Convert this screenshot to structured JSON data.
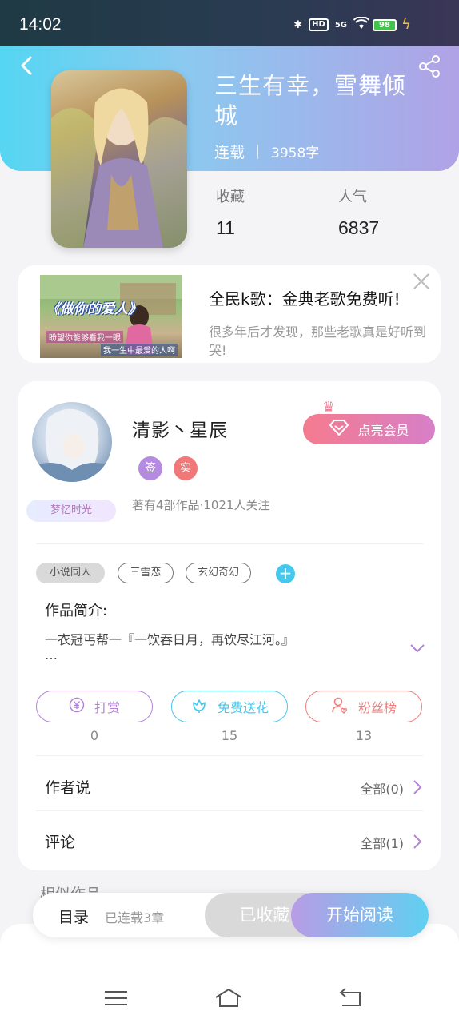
{
  "status_bar": {
    "time": "14:02",
    "network": "5G",
    "hd": "HD",
    "battery": "98"
  },
  "book": {
    "title": "三生有幸，雪舞倾城",
    "status": "连载",
    "words": "3958字",
    "stats": [
      {
        "label": "收藏",
        "value": "11"
      },
      {
        "label": "人气",
        "value": "6837"
      }
    ]
  },
  "ad": {
    "image_caption": "《做你的爱人》",
    "image_sub1": "盼望你能够看我一眼",
    "image_sub2": "我一生中最爱的人啊",
    "title": "全民k歌：金典老歌免费听!",
    "description": "很多年后才发现，那些老歌真是好听到哭!"
  },
  "author": {
    "name": "清影丶星辰",
    "badge": "梦忆时光",
    "tag_sign": "签",
    "tag_real": "实",
    "stats": "著有4部作品·1021人关注",
    "vip_label": "点亮会员"
  },
  "genres": [
    "小说同人",
    "三雪恋",
    "玄幻奇幻"
  ],
  "intro": {
    "label": "作品简介:",
    "text": "一衣冠丐帮一『一饮吞日月，再饮尽江河。』",
    "more": "…"
  },
  "actions": [
    {
      "label": "打赏",
      "count": "0",
      "icon": "yen-icon"
    },
    {
      "label": "免费送花",
      "count": "15",
      "icon": "flower-icon"
    },
    {
      "label": "粉丝榜",
      "count": "13",
      "icon": "fan-icon"
    }
  ],
  "rows": {
    "author_says": {
      "label": "作者说",
      "value": "全部(0)"
    },
    "comments": {
      "label": "评论",
      "value": "全部(1)"
    }
  },
  "similar_label": "相似作品",
  "bottom_bar": {
    "toc": "目录",
    "chapters": "已连载3章",
    "favorited": "已收藏",
    "start_reading": "开始阅读"
  },
  "colors": {
    "hero_start": "#55d6f2",
    "hero_end": "#b0a2e6",
    "accent_purple": "#b483d8",
    "accent_cyan": "#45c8ec",
    "accent_red": "#ee7f7f",
    "vip_start": "#f57b8e"
  }
}
